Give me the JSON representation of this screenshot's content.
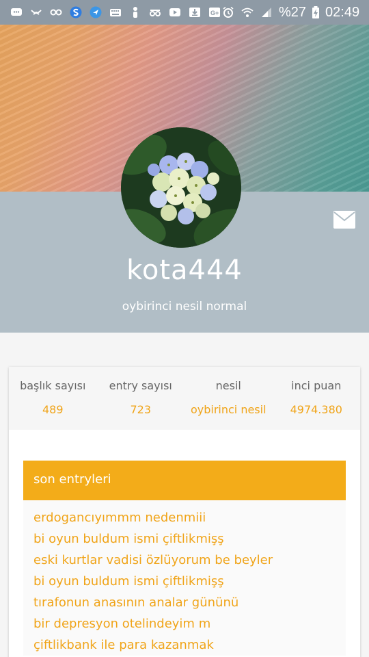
{
  "status_bar": {
    "battery_percent": "%27",
    "time": "02:49",
    "icons_left": [
      "message-icon",
      "voicemail-icon",
      "loop-icon",
      "s-app-icon",
      "send-app-icon",
      "keyboard-icon",
      "person-icon",
      "glasses-icon",
      "youtube-icon",
      "download-icon",
      "google-plus-icon"
    ],
    "icons_right": [
      "alarm-icon",
      "wifi-icon",
      "signal-icon",
      "battery-charging-icon"
    ]
  },
  "profile": {
    "username": "kota444",
    "generation_label": "oybirinci nesil normal"
  },
  "stats": [
    {
      "label": "başlık sayısı",
      "value": "489"
    },
    {
      "label": "entry sayısı",
      "value": "723"
    },
    {
      "label": "nesil",
      "value": "oybirinci nesil"
    },
    {
      "label": "inci puan",
      "value": "4974.380"
    }
  ],
  "entries": {
    "title": "son entryleri",
    "items": [
      "erdogancıyımmm nedenmiii",
      "bi oyun buldum ismi çiftlikmişş",
      "eski kurtlar vadisi özlüyorum be beyler",
      "bi oyun buldum ismi çiftlikmişş",
      "tırafonun anasının analar gününü",
      "bir depresyon otelindeyim m",
      "çiftlikbank ile para kazanmak"
    ]
  },
  "colors": {
    "accent": "#f3ac19",
    "panel": "#b1bec6",
    "status_bar": "#8e9aa5"
  }
}
